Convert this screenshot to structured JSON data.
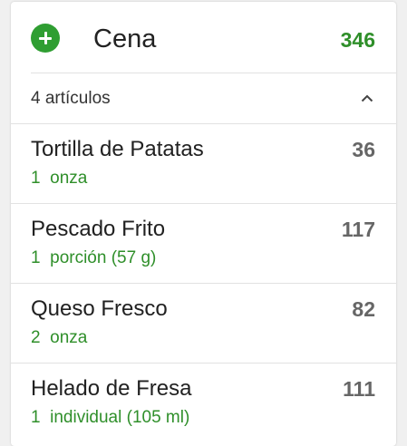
{
  "meal": {
    "title": "Cena",
    "total_calories": "346",
    "add_icon": "plus-circle-icon",
    "accent_color": "#2f8f2a"
  },
  "summary": {
    "text": "4 artículos",
    "toggle_icon": "chevron-up-icon"
  },
  "items": [
    {
      "name": "Tortilla de Patatas",
      "portion": "1  onza",
      "calories": "36"
    },
    {
      "name": "Pescado Frito",
      "portion": "1  porción (57 g)",
      "calories": "117"
    },
    {
      "name": "Queso Fresco",
      "portion": "2  onza",
      "calories": "82"
    },
    {
      "name": "Helado de Fresa",
      "portion": "1  individual (105 ml)",
      "calories": "111"
    }
  ]
}
